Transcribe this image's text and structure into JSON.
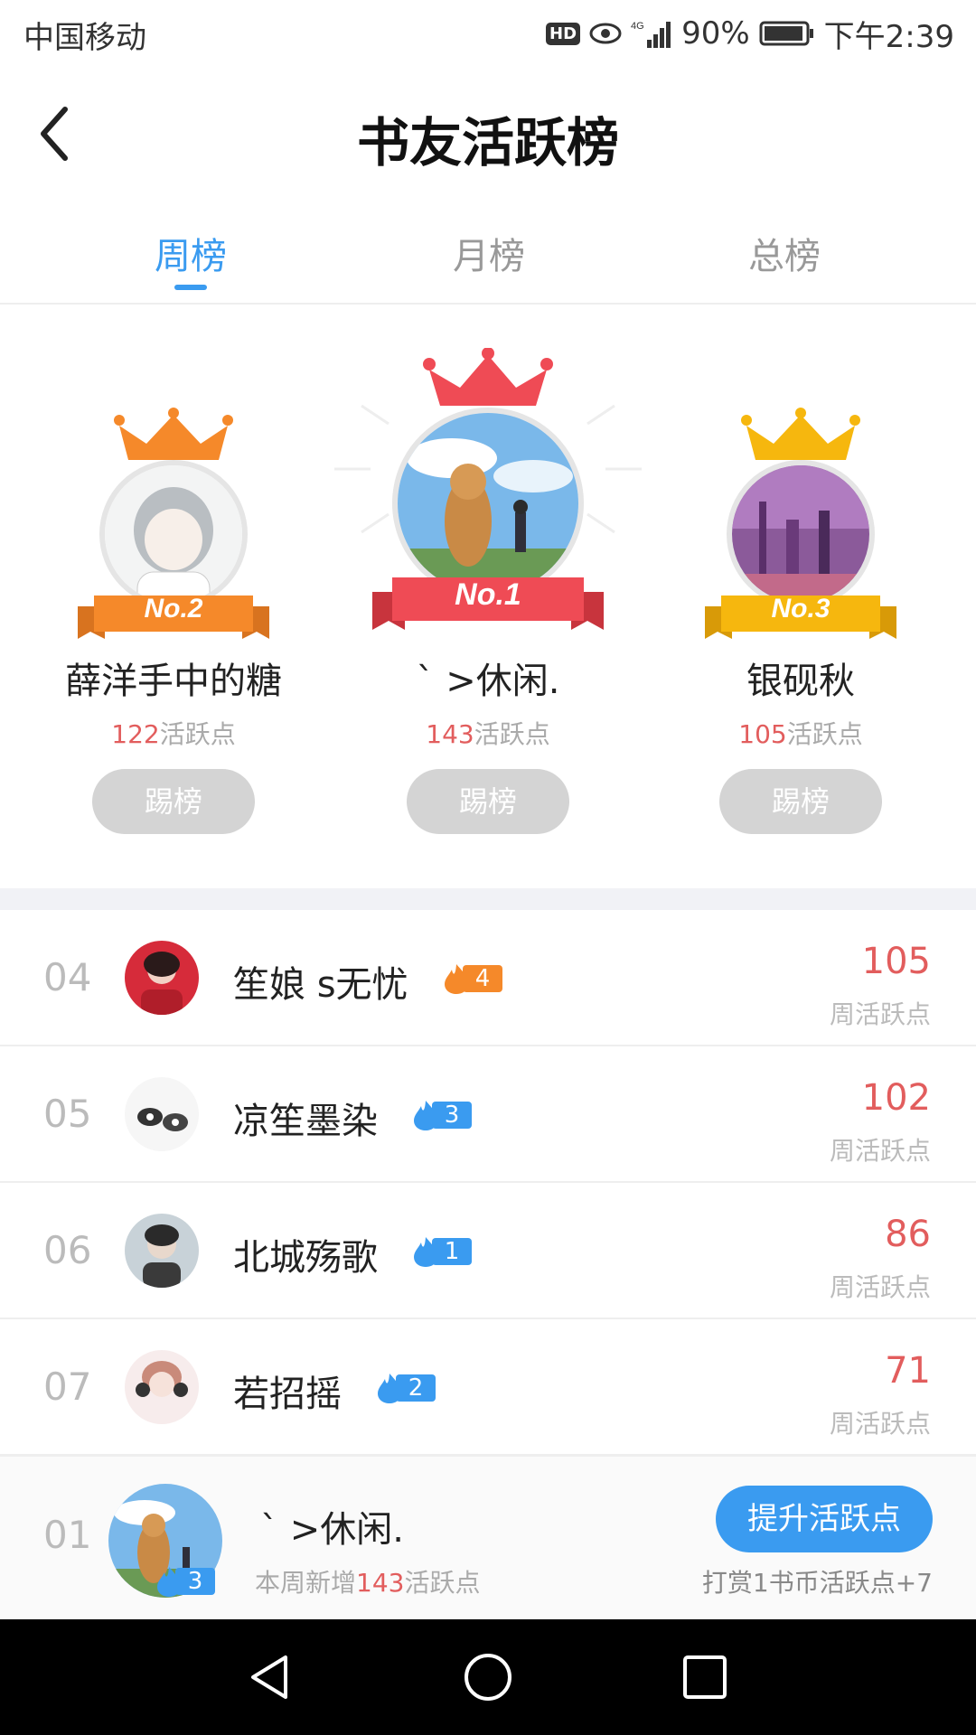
{
  "status_bar": {
    "carrier": "中国移动",
    "hd": "HD",
    "battery": "90%",
    "time": "下午2:39"
  },
  "header": {
    "title": "书友活跃榜"
  },
  "tabs": [
    {
      "label": "周榜",
      "active": true
    },
    {
      "label": "月榜",
      "active": false
    },
    {
      "label": "总榜",
      "active": false
    }
  ],
  "podium": {
    "first": {
      "rank_label": "No.1",
      "name": "ˋ >休闲.",
      "points": "143",
      "points_unit": "活跃点",
      "button": "踢榜",
      "color": "#ef4b55"
    },
    "second": {
      "rank_label": "No.2",
      "name": "薛洋手中的糖",
      "points": "122",
      "points_unit": "活跃点",
      "button": "踢榜",
      "color": "#f5892a"
    },
    "third": {
      "rank_label": "No.3",
      "name": "银砚秋",
      "points": "105",
      "points_unit": "活跃点",
      "button": "踢榜",
      "color": "#f6b70e"
    }
  },
  "rank_list": [
    {
      "rank": "04",
      "name": "笙娘 s无忧",
      "level": "4",
      "level_color": "#f5892a",
      "value": "105",
      "unit": "周活跃点"
    },
    {
      "rank": "05",
      "name": "凉笙墨染",
      "level": "3",
      "level_color": "#3a9bf0",
      "value": "102",
      "unit": "周活跃点"
    },
    {
      "rank": "06",
      "name": "北城殇歌",
      "level": "1",
      "level_color": "#3a9bf0",
      "value": "86",
      "unit": "周活跃点"
    },
    {
      "rank": "07",
      "name": "若招摇",
      "level": "2",
      "level_color": "#3a9bf0",
      "value": "71",
      "unit": "周活跃点"
    }
  ],
  "me": {
    "rank": "01",
    "name": "ˋ >休闲.",
    "level": "3",
    "desc_prefix": "本周新增",
    "desc_points": "143",
    "desc_suffix": "活跃点",
    "boost_button": "提升活跃点",
    "boost_note": "打赏1书币活跃点+7"
  },
  "colors": {
    "accent": "#3a9bf0",
    "points_red": "#e25d5d",
    "muted": "#bbbbbb"
  },
  "icons": [
    "back-icon",
    "eye-icon",
    "signal-icon",
    "battery-icon",
    "crown-icon",
    "flame-icon",
    "nav-back-icon",
    "nav-home-icon",
    "nav-recents-icon"
  ]
}
